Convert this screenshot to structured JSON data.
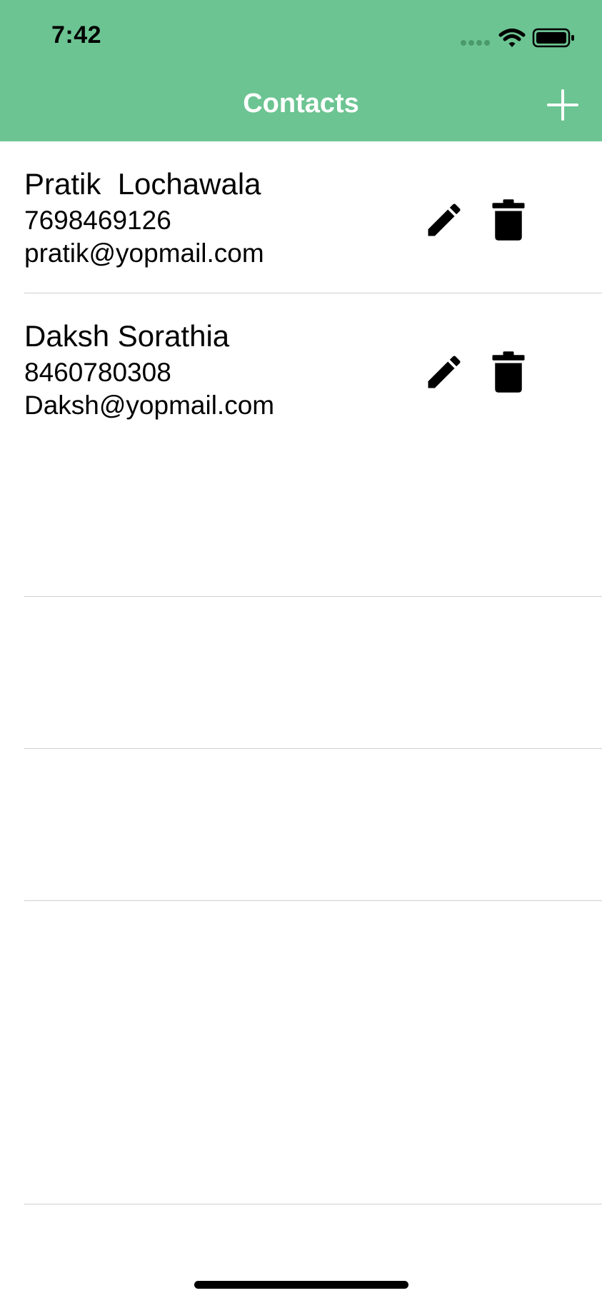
{
  "status_bar": {
    "time": "7:42"
  },
  "nav": {
    "title": "Contacts",
    "add_icon": "plus-icon"
  },
  "contacts": [
    {
      "name": "Pratik  Lochawala",
      "phone": "7698469126",
      "email": "pratik@yopmail.com"
    },
    {
      "name": "Daksh Sorathia",
      "phone": "8460780308",
      "email": "Daksh@yopmail.com"
    }
  ],
  "colors": {
    "header": "#6cc492",
    "header_text": "#ffffff",
    "text": "#000000",
    "separator": "#cfcfcf"
  }
}
